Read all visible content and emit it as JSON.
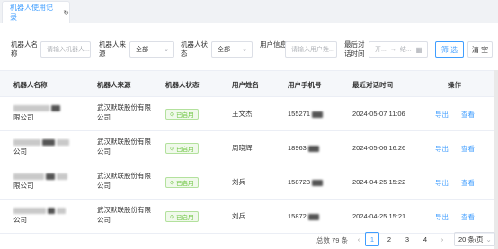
{
  "tab": {
    "label": "机器人使用记录"
  },
  "filters": {
    "robot_name_label": "机器人名称",
    "robot_name_placeholder": "请输入机器人...",
    "robot_source_label": "机器人来源",
    "robot_source_value": "全部",
    "robot_status_label": "机器人状态",
    "robot_status_value": "全部",
    "user_info_label": "用户信息",
    "user_info_placeholder": "请输入用户姓...",
    "last_time_label": "最后对话时间",
    "date_start": "开...",
    "date_sep": "→",
    "date_end": "结..."
  },
  "buttons": {
    "search": "筛 选",
    "clear": "清 空"
  },
  "table": {
    "headers": [
      "机器人名称",
      "机器人来源",
      "机器人状态",
      "用户姓名",
      "用户手机号",
      "最近对话时间",
      "操作"
    ],
    "rows": [
      {
        "name_suffix": "限公司",
        "source_line1": "武汉默联股份有限",
        "source_line2": "公司",
        "status": "已启用",
        "user": "王文杰",
        "phone": "155271",
        "time": "2024-05-07 11:06",
        "export": "导出",
        "view": "查看"
      },
      {
        "name_suffix": "公司",
        "source_line1": "武汉默联股份有限",
        "source_line2": "公司",
        "status": "已启用",
        "user": "周晓辉",
        "phone": "18963",
        "time": "2024-05-06 16:26",
        "export": "导出",
        "view": "查看"
      },
      {
        "name_suffix": "限公司",
        "source_line1": "武汉默联股份有限",
        "source_line2": "公司",
        "status": "已启用",
        "user": "刘兵",
        "phone": "158723",
        "time": "2024-04-25 15:22",
        "export": "导出",
        "view": "查看"
      },
      {
        "name_suffix": "公司",
        "source_line1": "武汉默联股份有限",
        "source_line2": "公司",
        "status": "已启用",
        "user": "刘兵",
        "phone": "15872",
        "time": "2024-04-25 15:21",
        "export": "导出",
        "view": "查看"
      }
    ]
  },
  "pagination": {
    "total": "总数 79 条",
    "pages": [
      "1",
      "2",
      "3",
      "4"
    ],
    "current": "1",
    "page_size": "20 条/页"
  }
}
